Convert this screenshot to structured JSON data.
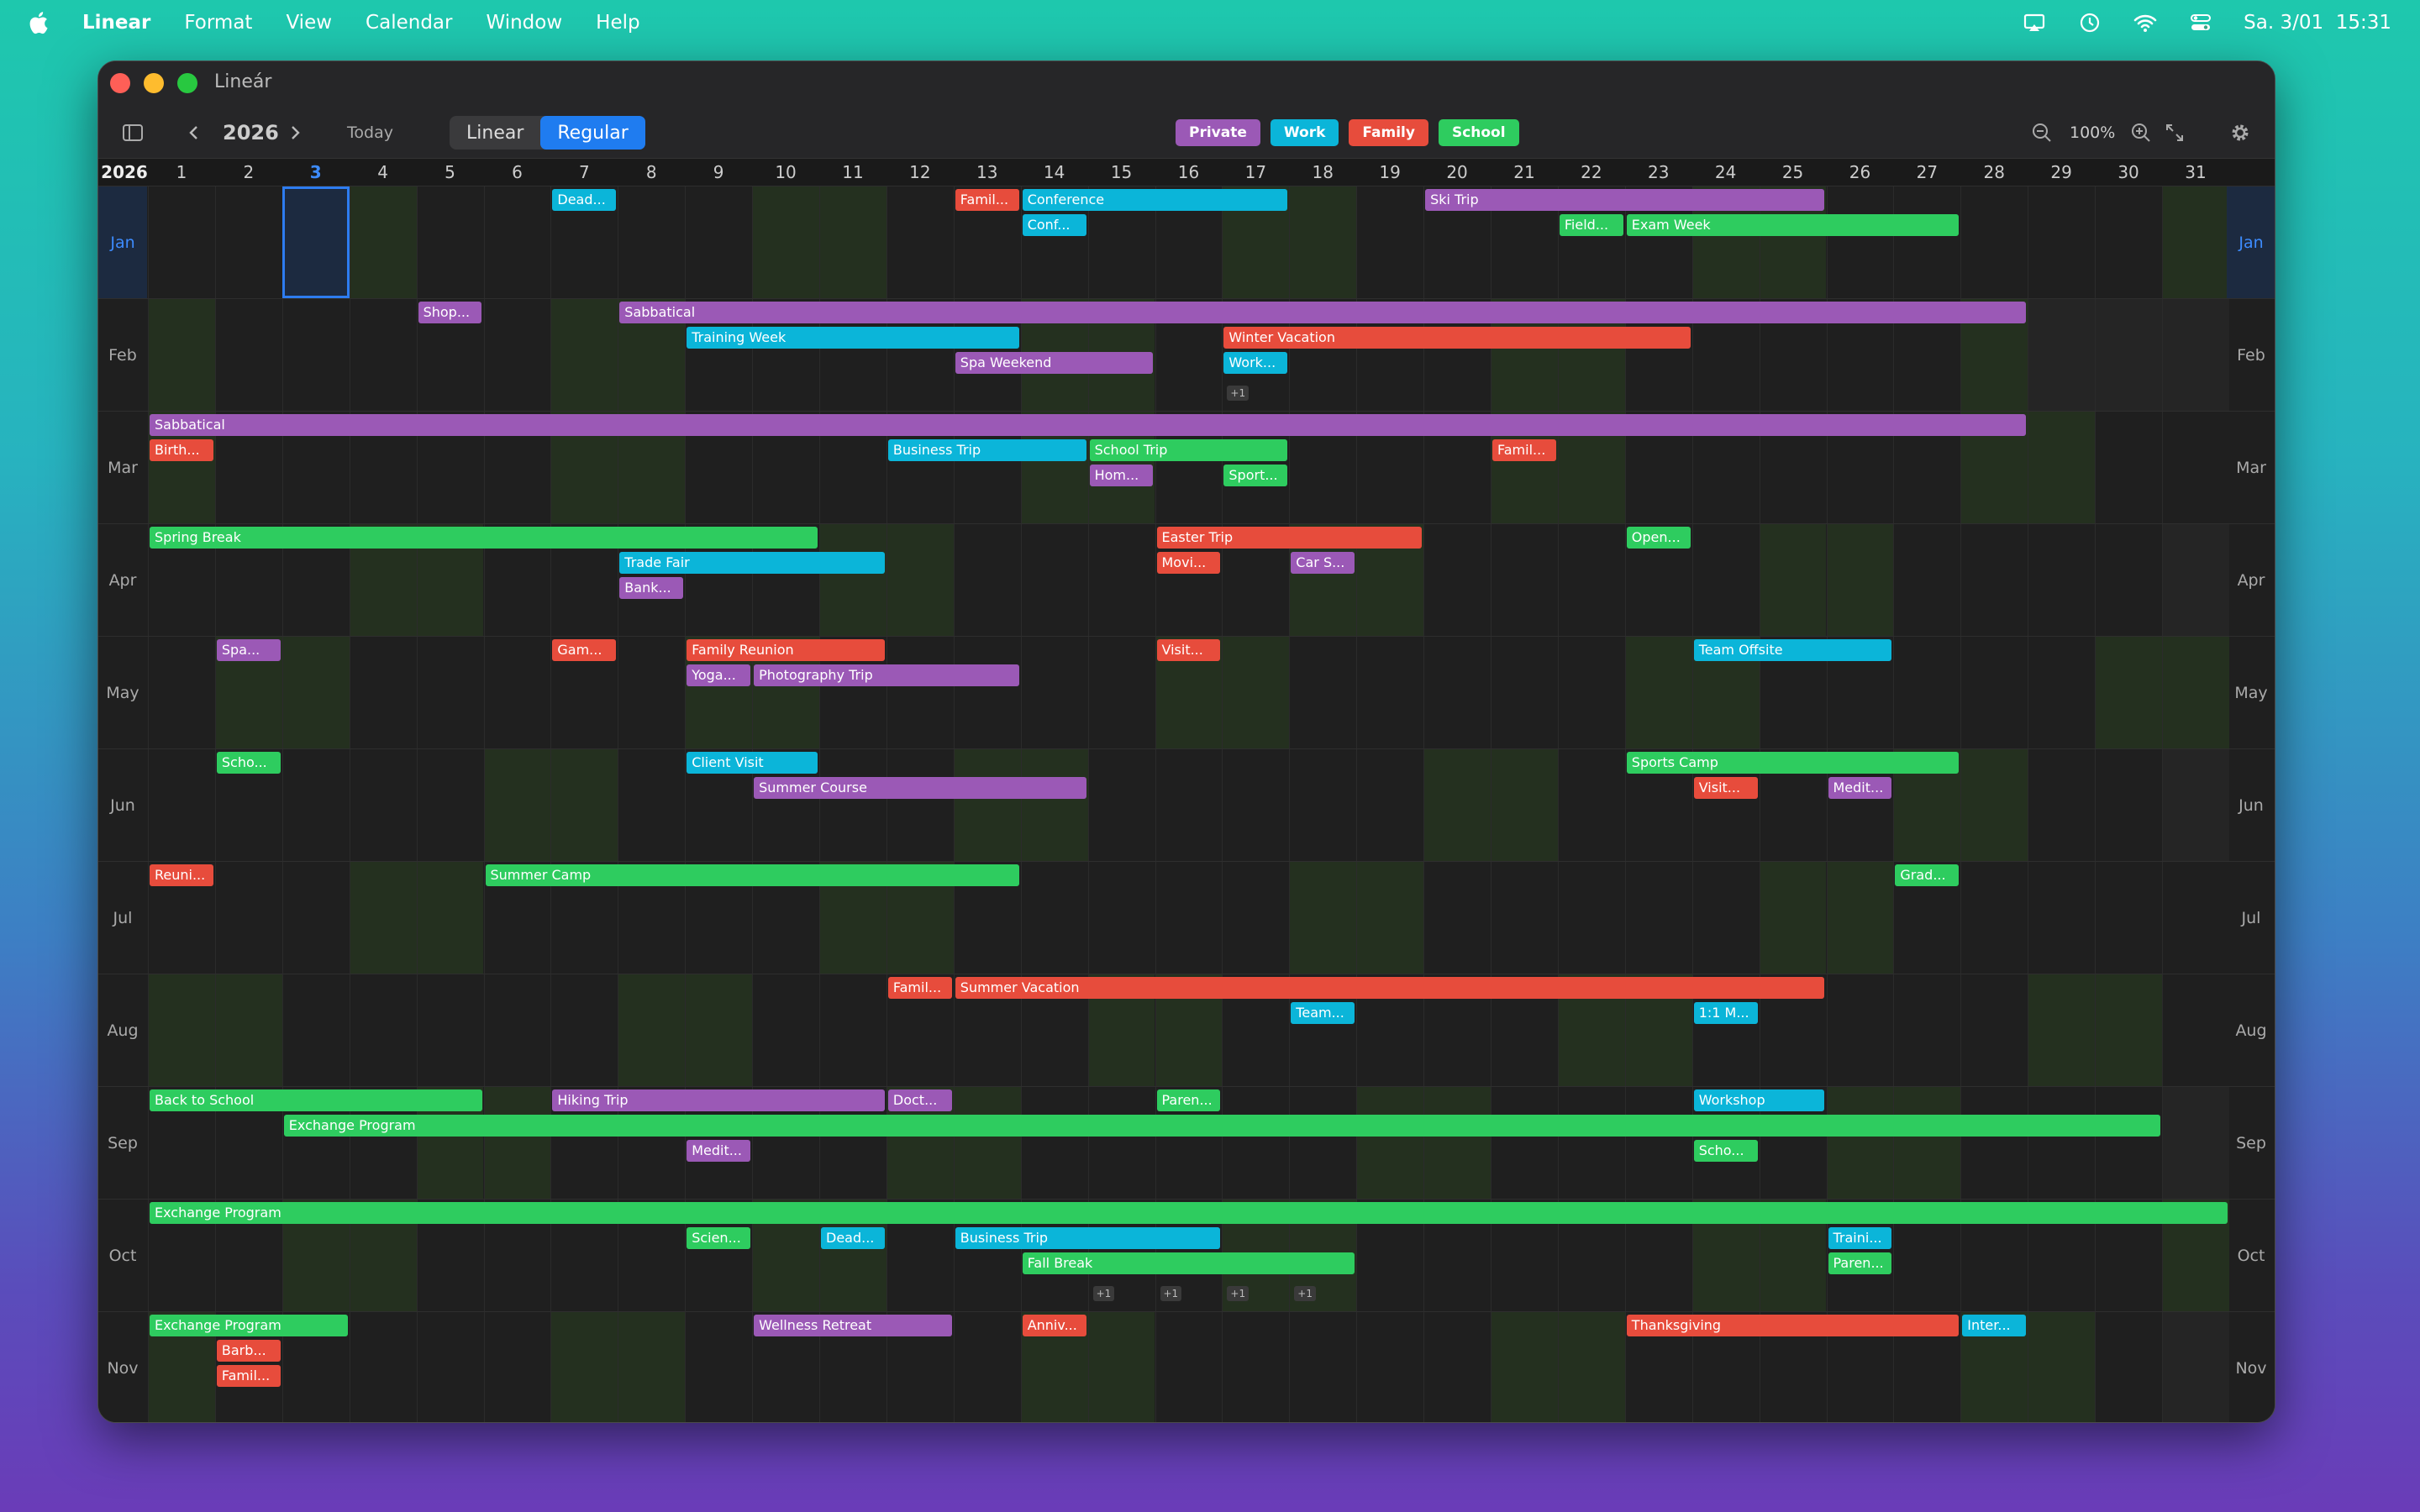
{
  "menubar": {
    "app": "Linear",
    "items": [
      "Format",
      "View",
      "Calendar",
      "Window",
      "Help"
    ],
    "clock": "Sa. 3/01  15:31"
  },
  "window": {
    "title": "Lineár"
  },
  "toolbar": {
    "year": "2026",
    "today": "Today",
    "modes": [
      "Linear",
      "Regular"
    ],
    "zoom": "100%"
  },
  "tags": [
    {
      "label": "Private",
      "color": "#9b59b6"
    },
    {
      "label": "Work",
      "color": "#0bb5d9"
    },
    {
      "label": "Family",
      "color": "#e74c3c"
    },
    {
      "label": "School",
      "color": "#2ecc5f"
    }
  ],
  "grid": {
    "year_label": "2026",
    "days": [
      "1",
      "2",
      "3",
      "4",
      "5",
      "6",
      "7",
      "8",
      "9",
      "10",
      "11",
      "12",
      "13",
      "14",
      "15",
      "16",
      "17",
      "18",
      "19",
      "20",
      "21",
      "22",
      "23",
      "24",
      "25",
      "26",
      "27",
      "28",
      "29",
      "30",
      "31"
    ],
    "today_day": 3,
    "months": [
      "Jan",
      "Feb",
      "Mar",
      "Apr",
      "May",
      "Jun",
      "Jul",
      "Aug",
      "Sep",
      "Oct",
      "Nov"
    ],
    "month_days": [
      31,
      28,
      31,
      30,
      31,
      30,
      31,
      31,
      30,
      31,
      30
    ],
    "start_weekday": [
      3,
      6,
      6,
      2,
      4,
      0,
      2,
      5,
      1,
      3,
      6
    ]
  },
  "events": [
    {
      "m": 0,
      "s": 7,
      "e": 7,
      "lane": 0,
      "label": "Dead...",
      "cat": "Work"
    },
    {
      "m": 0,
      "s": 13,
      "e": 13,
      "lane": 0,
      "label": "Famil...",
      "cat": "Family"
    },
    {
      "m": 0,
      "s": 14,
      "e": 17,
      "lane": 0,
      "label": "Conference",
      "cat": "Work"
    },
    {
      "m": 0,
      "s": 14,
      "e": 14,
      "lane": 1,
      "label": "Conf...",
      "cat": "Work"
    },
    {
      "m": 0,
      "s": 20,
      "e": 25,
      "lane": 0,
      "label": "Ski Trip",
      "cat": "Private"
    },
    {
      "m": 0,
      "s": 22,
      "e": 22,
      "lane": 1,
      "label": "Field...",
      "cat": "School"
    },
    {
      "m": 0,
      "s": 23,
      "e": 27,
      "lane": 1,
      "label": "Exam Week",
      "cat": "School"
    },
    {
      "m": 1,
      "s": 5,
      "e": 5,
      "lane": 0,
      "label": "Shop...",
      "cat": "Private"
    },
    {
      "m": 1,
      "s": 8,
      "e": 28,
      "lane": 0,
      "label": "Sabbatical",
      "cat": "Private"
    },
    {
      "m": 1,
      "s": 9,
      "e": 13,
      "lane": 1,
      "label": "Training Week",
      "cat": "Work"
    },
    {
      "m": 1,
      "s": 17,
      "e": 23,
      "lane": 1,
      "label": "Winter Vacation",
      "cat": "Family"
    },
    {
      "m": 1,
      "s": 13,
      "e": 15,
      "lane": 2,
      "label": "Spa Weekend",
      "cat": "Private"
    },
    {
      "m": 1,
      "s": 17,
      "e": 17,
      "lane": 2,
      "label": "Work...",
      "cat": "Work"
    },
    {
      "m": 2,
      "s": 1,
      "e": 28,
      "lane": 0,
      "label": "Sabbatical",
      "cat": "Private"
    },
    {
      "m": 2,
      "s": 1,
      "e": 1,
      "lane": 1,
      "label": "Birth...",
      "cat": "Family"
    },
    {
      "m": 2,
      "s": 12,
      "e": 14,
      "lane": 1,
      "label": "Business Trip",
      "cat": "Work"
    },
    {
      "m": 2,
      "s": 15,
      "e": 17,
      "lane": 1,
      "label": "School Trip",
      "cat": "School"
    },
    {
      "m": 2,
      "s": 21,
      "e": 21,
      "lane": 1,
      "label": "Famil...",
      "cat": "Family"
    },
    {
      "m": 2,
      "s": 15,
      "e": 15,
      "lane": 2,
      "label": "Hom...",
      "cat": "Private"
    },
    {
      "m": 2,
      "s": 17,
      "e": 17,
      "lane": 2,
      "label": "Sport...",
      "cat": "School"
    },
    {
      "m": 3,
      "s": 1,
      "e": 10,
      "lane": 0,
      "label": "Spring Break",
      "cat": "School"
    },
    {
      "m": 3,
      "s": 16,
      "e": 19,
      "lane": 0,
      "label": "Easter Trip",
      "cat": "Family"
    },
    {
      "m": 3,
      "s": 23,
      "e": 23,
      "lane": 0,
      "label": "Open...",
      "cat": "School"
    },
    {
      "m": 3,
      "s": 8,
      "e": 11,
      "lane": 1,
      "label": "Trade Fair",
      "cat": "Work"
    },
    {
      "m": 3,
      "s": 16,
      "e": 16,
      "lane": 1,
      "label": "Movi...",
      "cat": "Family"
    },
    {
      "m": 3,
      "s": 18,
      "e": 18,
      "lane": 1,
      "label": "Car S...",
      "cat": "Private"
    },
    {
      "m": 3,
      "s": 8,
      "e": 8,
      "lane": 2,
      "label": "Bank...",
      "cat": "Private"
    },
    {
      "m": 4,
      "s": 2,
      "e": 2,
      "lane": 0,
      "label": "Spa...",
      "cat": "Private"
    },
    {
      "m": 4,
      "s": 7,
      "e": 7,
      "lane": 0,
      "label": "Gam...",
      "cat": "Family"
    },
    {
      "m": 4,
      "s": 9,
      "e": 11,
      "lane": 0,
      "label": "Family Reunion",
      "cat": "Family"
    },
    {
      "m": 4,
      "s": 16,
      "e": 16,
      "lane": 0,
      "label": "Visit...",
      "cat": "Family"
    },
    {
      "m": 4,
      "s": 24,
      "e": 26,
      "lane": 0,
      "label": "Team Offsite",
      "cat": "Work"
    },
    {
      "m": 4,
      "s": 9,
      "e": 9,
      "lane": 1,
      "label": "Yoga...",
      "cat": "Private"
    },
    {
      "m": 4,
      "s": 10,
      "e": 13,
      "lane": 1,
      "label": "Photography Trip",
      "cat": "Private"
    },
    {
      "m": 5,
      "s": 2,
      "e": 2,
      "lane": 0,
      "label": "Scho...",
      "cat": "School"
    },
    {
      "m": 5,
      "s": 9,
      "e": 10,
      "lane": 0,
      "label": "Client Visit",
      "cat": "Work"
    },
    {
      "m": 5,
      "s": 23,
      "e": 27,
      "lane": 0,
      "label": "Sports Camp",
      "cat": "School"
    },
    {
      "m": 5,
      "s": 10,
      "e": 14,
      "lane": 1,
      "label": "Summer Course",
      "cat": "Private"
    },
    {
      "m": 5,
      "s": 24,
      "e": 24,
      "lane": 1,
      "label": "Visit...",
      "cat": "Family"
    },
    {
      "m": 5,
      "s": 26,
      "e": 26,
      "lane": 1,
      "label": "Medit...",
      "cat": "Private"
    },
    {
      "m": 6,
      "s": 1,
      "e": 1,
      "lane": 0,
      "label": "Reuni...",
      "cat": "Family"
    },
    {
      "m": 6,
      "s": 6,
      "e": 13,
      "lane": 0,
      "label": "Summer Camp",
      "cat": "School"
    },
    {
      "m": 6,
      "s": 27,
      "e": 27,
      "lane": 0,
      "label": "Grad...",
      "cat": "School"
    },
    {
      "m": 7,
      "s": 12,
      "e": 12,
      "lane": 0,
      "label": "Famil...",
      "cat": "Family"
    },
    {
      "m": 7,
      "s": 13,
      "e": 25,
      "lane": 0,
      "label": "Summer Vacation",
      "cat": "Family"
    },
    {
      "m": 7,
      "s": 18,
      "e": 18,
      "lane": 1,
      "label": "Team...",
      "cat": "Work"
    },
    {
      "m": 7,
      "s": 24,
      "e": 24,
      "lane": 1,
      "label": "1:1 M...",
      "cat": "Work"
    },
    {
      "m": 8,
      "s": 1,
      "e": 5,
      "lane": 0,
      "label": "Back to School",
      "cat": "School"
    },
    {
      "m": 8,
      "s": 7,
      "e": 11,
      "lane": 0,
      "label": "Hiking Trip",
      "cat": "Private"
    },
    {
      "m": 8,
      "s": 12,
      "e": 12,
      "lane": 0,
      "label": "Doct...",
      "cat": "Private"
    },
    {
      "m": 8,
      "s": 16,
      "e": 16,
      "lane": 0,
      "label": "Paren...",
      "cat": "School"
    },
    {
      "m": 8,
      "s": 24,
      "e": 25,
      "lane": 0,
      "label": "Workshop",
      "cat": "Work"
    },
    {
      "m": 8,
      "s": 3,
      "e": 30,
      "lane": 1,
      "label": "Exchange Program",
      "cat": "School"
    },
    {
      "m": 8,
      "s": 9,
      "e": 9,
      "lane": 2,
      "label": "Medit...",
      "cat": "Private"
    },
    {
      "m": 8,
      "s": 24,
      "e": 24,
      "lane": 2,
      "label": "Scho...",
      "cat": "School"
    },
    {
      "m": 9,
      "s": 1,
      "e": 31,
      "lane": 0,
      "label": "Exchange Program",
      "cat": "School"
    },
    {
      "m": 9,
      "s": 9,
      "e": 9,
      "lane": 1,
      "label": "Scien...",
      "cat": "School"
    },
    {
      "m": 9,
      "s": 11,
      "e": 11,
      "lane": 1,
      "label": "Dead...",
      "cat": "Work"
    },
    {
      "m": 9,
      "s": 13,
      "e": 16,
      "lane": 1,
      "label": "Business Trip",
      "cat": "Work"
    },
    {
      "m": 9,
      "s": 26,
      "e": 26,
      "lane": 1,
      "label": "Traini...",
      "cat": "Work"
    },
    {
      "m": 9,
      "s": 14,
      "e": 18,
      "lane": 2,
      "label": "Fall Break",
      "cat": "School"
    },
    {
      "m": 9,
      "s": 26,
      "e": 26,
      "lane": 2,
      "label": "Paren...",
      "cat": "School"
    },
    {
      "m": 10,
      "s": 1,
      "e": 3,
      "lane": 0,
      "label": "Exchange Program",
      "cat": "School"
    },
    {
      "m": 10,
      "s": 10,
      "e": 12,
      "lane": 0,
      "label": "Wellness Retreat",
      "cat": "Private"
    },
    {
      "m": 10,
      "s": 14,
      "e": 14,
      "lane": 0,
      "label": "Anniv...",
      "cat": "Family"
    },
    {
      "m": 10,
      "s": 23,
      "e": 27,
      "lane": 0,
      "label": "Thanksgiving",
      "cat": "Family"
    },
    {
      "m": 10,
      "s": 28,
      "e": 28,
      "lane": 0,
      "label": "Inter...",
      "cat": "Work"
    },
    {
      "m": 10,
      "s": 2,
      "e": 2,
      "lane": 1,
      "label": "Barb...",
      "cat": "Family"
    },
    {
      "m": 10,
      "s": 2,
      "e": 2,
      "lane": 2,
      "label": "Famil...",
      "cat": "Family"
    }
  ],
  "more": [
    {
      "m": 1,
      "d": 17,
      "label": "+1"
    },
    {
      "m": 9,
      "d": 15,
      "label": "+1"
    },
    {
      "m": 9,
      "d": 16,
      "label": "+1"
    },
    {
      "m": 9,
      "d": 17,
      "label": "+1"
    },
    {
      "m": 9,
      "d": 18,
      "label": "+1"
    }
  ]
}
